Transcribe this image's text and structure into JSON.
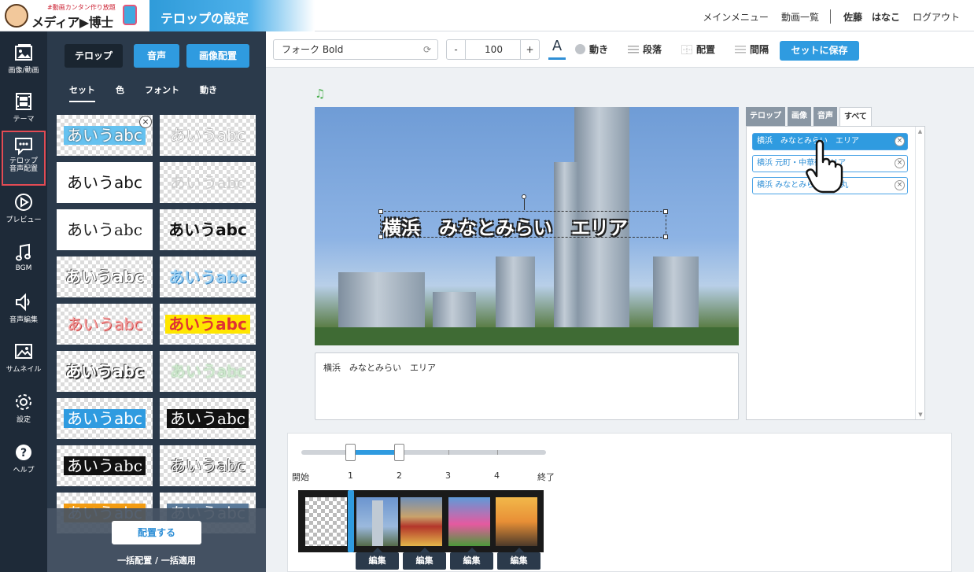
{
  "header": {
    "logo_tagline": "#動画カンタン作り放題",
    "logo_brand": "メディア▶博士",
    "page_title": "テロップの設定",
    "nav": [
      "メインメニュー",
      "動画一覧",
      "佐藤　はなこ",
      "ログアウト"
    ]
  },
  "rail": [
    {
      "label": "画像/動画",
      "icon": "image-icon"
    },
    {
      "label": "テーマ",
      "icon": "film-icon"
    },
    {
      "label": "テロップ 音声配置",
      "icon": "speech-bubble-icon",
      "active": true
    },
    {
      "label": "プレビュー",
      "icon": "play-circle-icon"
    },
    {
      "label": "BGM",
      "icon": "music-note-icon"
    },
    {
      "label": "音声編集",
      "icon": "speaker-icon"
    },
    {
      "label": "サムネイル",
      "icon": "picture-icon"
    },
    {
      "label": "設定",
      "icon": "gear-icon"
    },
    {
      "label": "ヘルプ",
      "icon": "help-icon"
    }
  ],
  "panel": {
    "tabs": [
      "テロップ",
      "音声",
      "画像配置"
    ],
    "subtabs": [
      "セット",
      "色",
      "フォント",
      "動き"
    ],
    "sample_text": "あいうabc",
    "place_button": "配置する",
    "bulk_links": "一括配置 / 一括適用"
  },
  "toolbar": {
    "font_name": "フォーク Bold",
    "minus": "-",
    "size": "100",
    "plus": "+",
    "text_color_glyph": "A",
    "items": [
      "動き",
      "段落",
      "配置",
      "間隔"
    ],
    "save_button": "セットに保存"
  },
  "workspace": {
    "music_glyph": "♫",
    "caption": "横浜　みなとみらい　エリア",
    "textbox_value": "横浜　みなとみらい　エリア"
  },
  "right_panel": {
    "tabs": [
      "テロップ",
      "画像",
      "音声",
      "すべて"
    ],
    "items": [
      "横浜　みなとみらい　エリア",
      "横浜 元町・中華街エリア",
      "横浜 みなとみらい 日本丸"
    ]
  },
  "timeline": {
    "labels": [
      "開始",
      "1",
      "2",
      "3",
      "4",
      "終了"
    ],
    "edit_label": "編集"
  },
  "colors": {
    "accent_blue": "#2f9be0",
    "sidebar_dark": "#1e2a38",
    "panel_dark": "#2b3a4b",
    "active_outline": "#e34b54"
  }
}
